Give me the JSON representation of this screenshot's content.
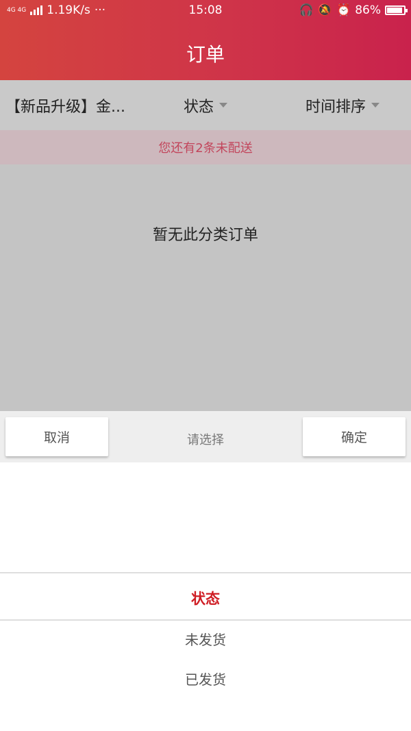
{
  "status_bar": {
    "network": "4G 4G",
    "speed": "1.19K/s",
    "more": "···",
    "time": "15:08",
    "battery": "86%",
    "icons": [
      "headset-icon",
      "mute-bell-icon",
      "alarm-icon",
      "battery-icon"
    ]
  },
  "header": {
    "title": "订单"
  },
  "filters": {
    "product": "【新品升级】金...",
    "status": "状态",
    "sort": "时间排序"
  },
  "notice": "您还有2条未配送",
  "empty_message": "暂无此分类订单",
  "picker": {
    "cancel_label": "取消",
    "prompt": "请选择",
    "confirm_label": "确定",
    "options": [
      "状态",
      "未发货",
      "已发货"
    ],
    "selected_index": 0
  },
  "colors": {
    "accent": "#cf1d24",
    "header_start": "#d4443f",
    "header_end": "#c9224c",
    "notice_text": "#c2465c"
  }
}
